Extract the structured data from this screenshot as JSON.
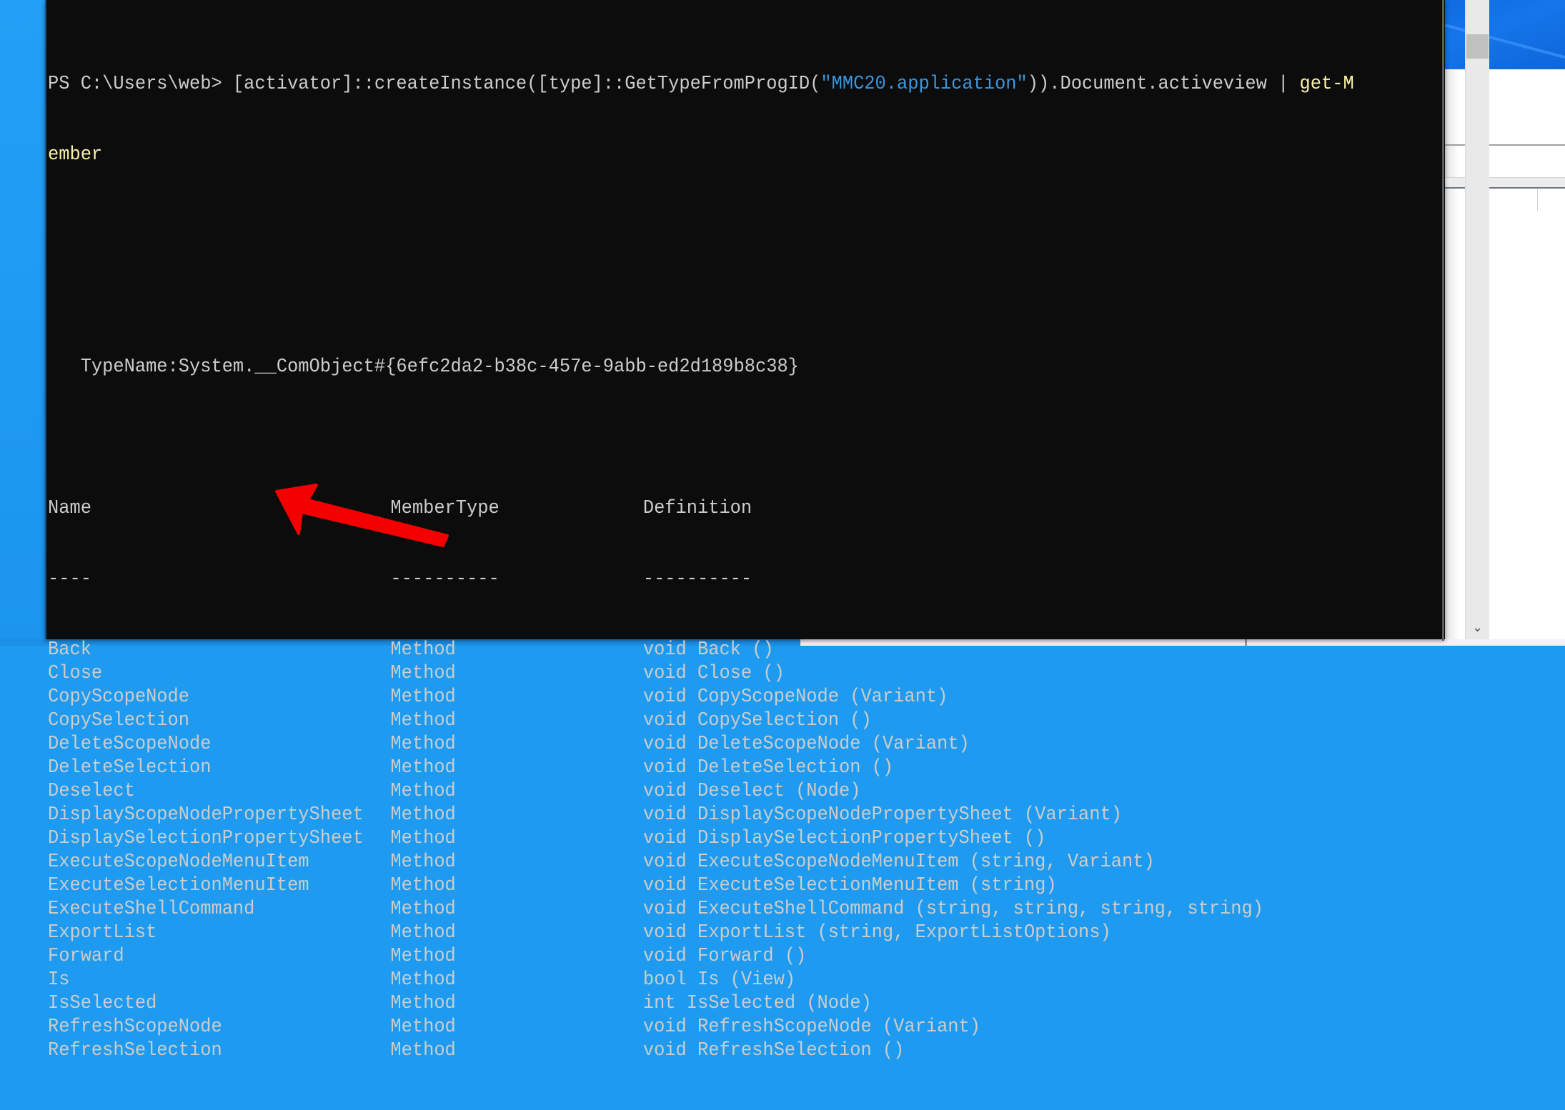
{
  "terminal": {
    "prompt": "PS C:\\Users\\web> ",
    "command_parts": [
      {
        "text": "[activator]::createInstance([type]::GetTypeFromProgID(",
        "color": "gray"
      },
      {
        "text": "\"MMC20.application\"",
        "color": "blue"
      },
      {
        "text": ")).Document.activeview | ",
        "color": "gray"
      },
      {
        "text": "get-M",
        "color": "yellow"
      }
    ],
    "command_wrap": "ember",
    "typename": "   TypeName:System.__ComObject#{6efc2da2-b38c-457e-9abb-ed2d189b8c38}",
    "columns": {
      "name": "Name",
      "member_type": "MemberType",
      "definition": "Definition",
      "name_rule": "----",
      "member_type_rule": "----------",
      "definition_rule": "----------"
    },
    "rows": [
      {
        "name": "Back",
        "type": "Method",
        "definition": "void Back ()"
      },
      {
        "name": "Close",
        "type": "Method",
        "definition": "void Close ()"
      },
      {
        "name": "CopyScopeNode",
        "type": "Method",
        "definition": "void CopyScopeNode (Variant)"
      },
      {
        "name": "CopySelection",
        "type": "Method",
        "definition": "void CopySelection ()"
      },
      {
        "name": "DeleteScopeNode",
        "type": "Method",
        "definition": "void DeleteScopeNode (Variant)"
      },
      {
        "name": "DeleteSelection",
        "type": "Method",
        "definition": "void DeleteSelection ()"
      },
      {
        "name": "Deselect",
        "type": "Method",
        "definition": "void Deselect (Node)"
      },
      {
        "name": "DisplayScopeNodePropertySheet",
        "type": "Method",
        "definition": "void DisplayScopeNodePropertySheet (Variant)"
      },
      {
        "name": "DisplaySelectionPropertySheet",
        "type": "Method",
        "definition": "void DisplaySelectionPropertySheet ()"
      },
      {
        "name": "ExecuteScopeNodeMenuItem",
        "type": "Method",
        "definition": "void ExecuteScopeNodeMenuItem (string, Variant)"
      },
      {
        "name": "ExecuteSelectionMenuItem",
        "type": "Method",
        "definition": "void ExecuteSelectionMenuItem (string)"
      },
      {
        "name": "ExecuteShellCommand",
        "type": "Method",
        "definition": "void ExecuteShellCommand (string, string, string, string)"
      },
      {
        "name": "ExportList",
        "type": "Method",
        "definition": "void ExportList (string, ExportListOptions)"
      },
      {
        "name": "Forward",
        "type": "Method",
        "definition": "void Forward ()"
      },
      {
        "name": "Is",
        "type": "Method",
        "definition": "bool Is (View)"
      },
      {
        "name": "IsSelected",
        "type": "Method",
        "definition": "int IsSelected (Node)"
      },
      {
        "name": "RefreshScopeNode",
        "type": "Method",
        "definition": "void RefreshScopeNode (Variant)"
      },
      {
        "name": "RefreshSelection",
        "type": "Method",
        "definition": "void RefreshSelection ()"
      }
    ]
  },
  "annotation": {
    "highlighted_member": "ExecuteShellCommand",
    "arrow_color": "#f50000"
  },
  "scrollbar": {
    "down_icon": "chevron-down-icon",
    "down_glyph": "⌄"
  },
  "colors": {
    "terminal_bg": "#0c0c0c",
    "text": "#cccccc",
    "string": "#3a96dd",
    "command": "#f9f1a5"
  }
}
